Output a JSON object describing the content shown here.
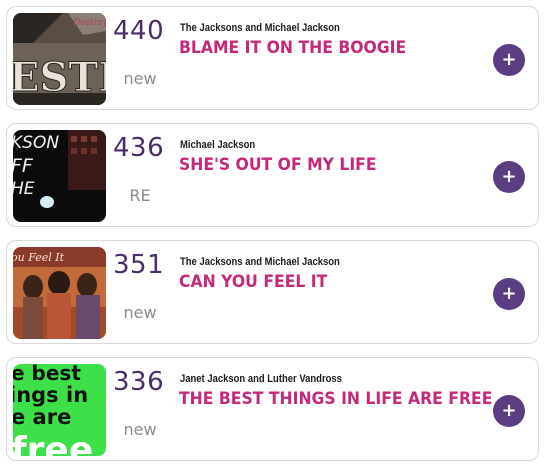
{
  "entries": [
    {
      "rank": "440",
      "status": "new",
      "artist": "The Jacksons and Michael Jackson",
      "title": "BLAME IT ON THE BOOGIE",
      "add_icon": "plus",
      "cover_icon": "album-cover-destiny"
    },
    {
      "rank": "436",
      "status": "RE",
      "artist": "Michael Jackson",
      "title": "SHE'S OUT OF MY LIFE",
      "add_icon": "plus",
      "cover_icon": "album-cover-off-the-wall"
    },
    {
      "rank": "351",
      "status": "new",
      "artist": "The Jacksons and Michael Jackson",
      "title": "CAN YOU FEEL IT",
      "add_icon": "plus",
      "cover_icon": "album-cover-can-you-feel-it"
    },
    {
      "rank": "336",
      "status": "new",
      "artist": "Janet Jackson and Luther Vandross",
      "title": "THE BEST THINGS IN LIFE ARE FREE",
      "add_icon": "plus",
      "cover_icon": "album-cover-best-things"
    }
  ],
  "colors": {
    "rank": "#4a2c6b",
    "title": "#c4287a",
    "status": "#8c8c8c",
    "button": "#5b3d82",
    "border": "#d9d9d9"
  },
  "cover_text": {
    "cover_1": "ESTI",
    "cover_2_line1": "KSON",
    "cover_2_line2": "FF",
    "cover_2_line3": "HE",
    "cover_3": "ou Feel It",
    "cover_4_line1": "e best",
    "cover_4_line2": "ings in",
    "cover_4_line3": "e are",
    "cover_4_line4": "free"
  }
}
